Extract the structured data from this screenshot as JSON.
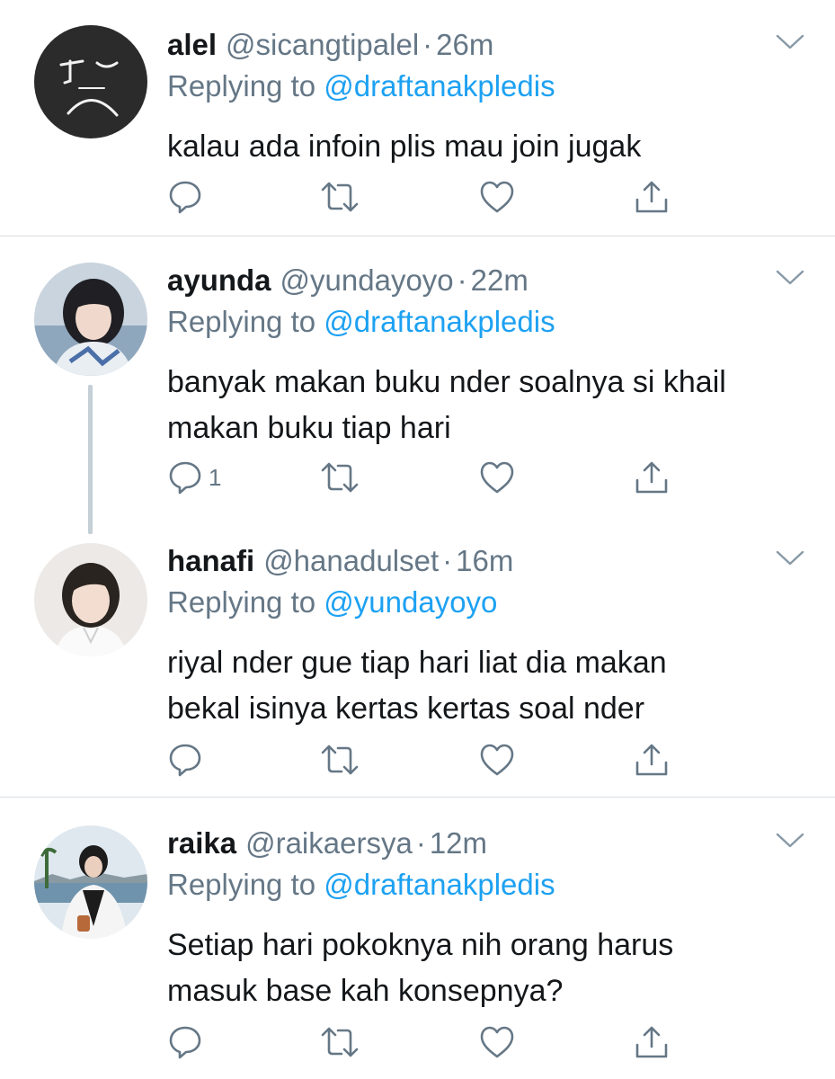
{
  "tweets": [
    {
      "name": "alel",
      "handle": "@sicangtipalel",
      "separator": "·",
      "time": "26m",
      "replying_label": "Replying to",
      "replying_to": "@draftanakpledis",
      "lines": [
        "kalau ada infoin plis mau join jugak"
      ],
      "reply_count": ""
    },
    {
      "name": "ayunda",
      "handle": "@yundayoyo",
      "separator": "·",
      "time": "22m",
      "replying_label": "Replying to",
      "replying_to": "@draftanakpledis",
      "lines": [
        "banyak makan buku nder soalnya si khail",
        "makan buku tiap hari"
      ],
      "reply_count": "1"
    },
    {
      "name": "hanafi",
      "handle": "@hanadulset",
      "separator": "·",
      "time": "16m",
      "replying_label": "Replying to",
      "replying_to": "@yundayoyo",
      "lines": [
        "riyal nder gue tiap hari liat dia makan",
        "bekal isinya kertas kertas soal nder"
      ],
      "reply_count": ""
    },
    {
      "name": "raika",
      "handle": "@raikaersya",
      "separator": "·",
      "time": "12m",
      "replying_label": "Replying to",
      "replying_to": "@draftanakpledis",
      "lines": [
        "Setiap hari pokoknya nih orang harus",
        "masuk base kah konsepnya?"
      ],
      "reply_count": ""
    }
  ],
  "colors": {
    "text": "#14171a",
    "secondary": "#657786",
    "link": "#1da1f2",
    "divider": "#d9dde0",
    "thread_line": "#c4cfd6"
  },
  "icons": [
    "chevron-down-icon",
    "reply-icon",
    "retweet-icon",
    "like-icon",
    "share-icon"
  ]
}
